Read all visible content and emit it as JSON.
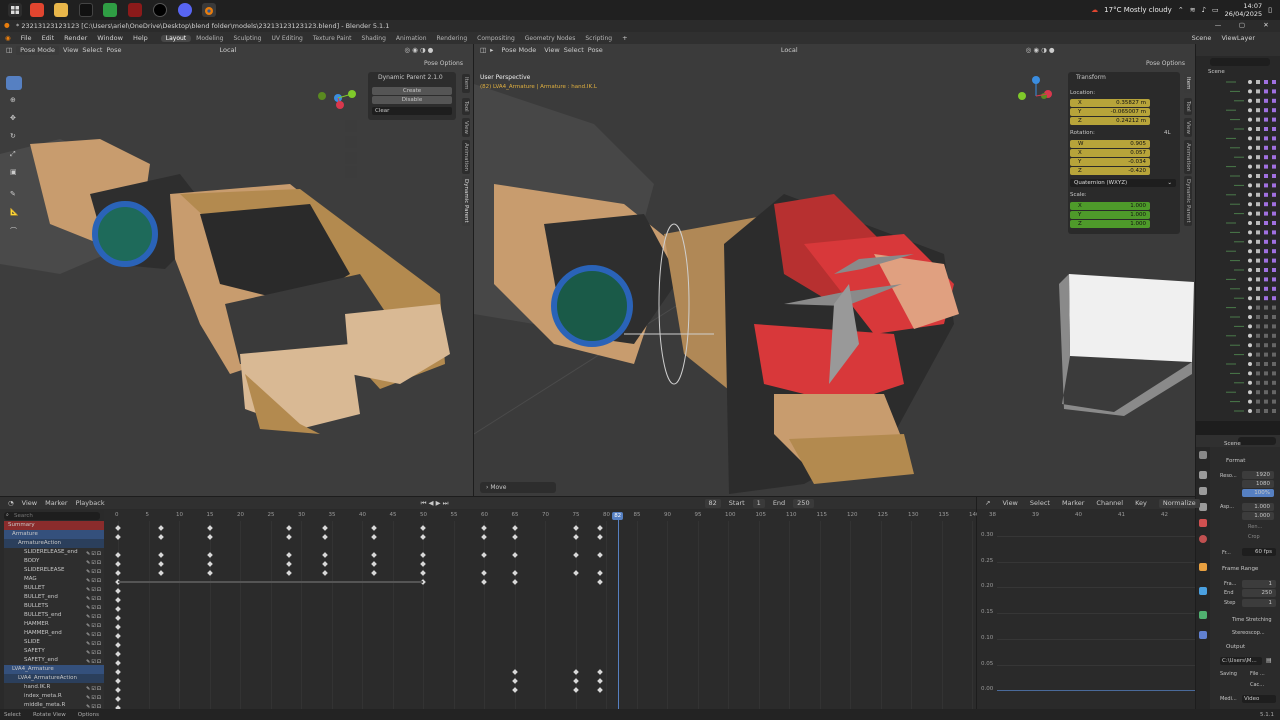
{
  "taskbar": {
    "weather": "17°C  Mostly cloudy",
    "time": "14:07",
    "date": "26/04/2025"
  },
  "window": {
    "title": "* 23213123123123 [C:\\Users\\ariel\\OneDrive\\Desktop\\blend folder\\models\\23213123123123.blend] - Blender 5.1.1"
  },
  "topbar": {
    "menus": [
      "File",
      "Edit",
      "Render",
      "Window",
      "Help"
    ],
    "workspaces": [
      "Layout",
      "Modeling",
      "Sculpting",
      "UV Editing",
      "Texture Paint",
      "Shading",
      "Animation",
      "Rendering",
      "Compositing",
      "Geometry Nodes",
      "Scripting"
    ],
    "active_workspace": "Layout",
    "scene": "Scene",
    "view_layer": "ViewLayer"
  },
  "left_viewport": {
    "mode": "Pose Mode",
    "menus": [
      "View",
      "Select",
      "Pose"
    ],
    "orientation": "Local",
    "pose_options": "Pose Options",
    "dynamic_parent": {
      "title": "Dynamic Parent 2.1.0",
      "create": "Create",
      "disable": "Disable",
      "clear": "Clear"
    },
    "side_tabs": [
      "Item",
      "Tool",
      "View",
      "Animation",
      "Dynamic Parent"
    ]
  },
  "right_viewport": {
    "mode": "Pose Mode",
    "menus": [
      "View",
      "Select",
      "Pose"
    ],
    "orientation": "Local",
    "pose_options": "Pose Options",
    "perspective": "User Perspective",
    "active_info": "(82) LVA4_Armature | Armature : hand.IK.L",
    "operator_panel": "Move",
    "side_tabs": [
      "Item",
      "Tool",
      "View",
      "Animation",
      "Dynamic Parent"
    ],
    "transform": {
      "title": "Transform",
      "location_label": "Location:",
      "location": [
        {
          "axis": "X",
          "value": "0.35827 m"
        },
        {
          "axis": "Y",
          "value": "-0.065007 m"
        },
        {
          "axis": "Z",
          "value": "0.24212 m"
        }
      ],
      "rotation_label": "Rotation:",
      "rotation_mode_short": "4L",
      "rotation": [
        {
          "axis": "W",
          "value": "0.905"
        },
        {
          "axis": "X",
          "value": "0.057"
        },
        {
          "axis": "Y",
          "value": "-0.034"
        },
        {
          "axis": "Z",
          "value": "-0.420"
        }
      ],
      "rotation_mode": "Quaternion (WXYZ)",
      "scale_label": "Scale:",
      "scale": [
        {
          "axis": "X",
          "value": "1.000"
        },
        {
          "axis": "Y",
          "value": "1.000"
        },
        {
          "axis": "Z",
          "value": "1.000"
        }
      ]
    }
  },
  "dope_sheet": {
    "menus": [
      "View",
      "Marker",
      "Playback"
    ],
    "current_frame": "82",
    "start_label": "Start",
    "start": "1",
    "end_label": "End",
    "end": "250",
    "search_placeholder": "Search",
    "ticks": [
      "0",
      "5",
      "10",
      "15",
      "20",
      "25",
      "30",
      "35",
      "40",
      "45",
      "50",
      "55",
      "60",
      "65",
      "70",
      "75",
      "80",
      "85",
      "90",
      "95",
      "100",
      "105",
      "110",
      "115",
      "120",
      "125",
      "130",
      "135",
      "140"
    ],
    "channels": [
      {
        "name": "Summary",
        "kind": "summary"
      },
      {
        "name": "Armature",
        "kind": "object"
      },
      {
        "name": "ArmatureAction",
        "kind": "action"
      },
      {
        "name": "SLIDERELEASE_end",
        "kind": "group"
      },
      {
        "name": "BODY",
        "kind": "group"
      },
      {
        "name": "SLIDERELEASE",
        "kind": "group"
      },
      {
        "name": "MAG",
        "kind": "group"
      },
      {
        "name": "BULLET",
        "kind": "group"
      },
      {
        "name": "BULLET_end",
        "kind": "group"
      },
      {
        "name": "BULLETS",
        "kind": "group"
      },
      {
        "name": "BULLETS_end",
        "kind": "group"
      },
      {
        "name": "HAMMER",
        "kind": "group"
      },
      {
        "name": "HAMMER_end",
        "kind": "group"
      },
      {
        "name": "SLIDE",
        "kind": "group"
      },
      {
        "name": "SAFETY",
        "kind": "group"
      },
      {
        "name": "SAFETY_end",
        "kind": "group"
      },
      {
        "name": "LVA4_Armature",
        "kind": "object"
      },
      {
        "name": "LVA4_ArmatureAction",
        "kind": "action"
      },
      {
        "name": "hand.IK.R",
        "kind": "group"
      },
      {
        "name": "index_meta.R",
        "kind": "group"
      },
      {
        "name": "middle_meta.R",
        "kind": "group"
      }
    ]
  },
  "graph_editor": {
    "menus": [
      "View",
      "Select",
      "Marker",
      "Channel",
      "Key"
    ],
    "normalize": "Normalize",
    "ticks": [
      "38",
      "39",
      "40",
      "41",
      "42"
    ],
    "y_ticks": [
      "0.30",
      "0.25",
      "0.20",
      "0.15",
      "0.10",
      "0.05",
      "0.00"
    ]
  },
  "properties": {
    "scene": "Scene",
    "format": "Format",
    "resolution_label": "Reso...",
    "res_x": "1920",
    "res_y": "1080",
    "res_pct": "100%",
    "aspect_label": "Asp...",
    "aspect_x": "1.000",
    "aspect_y": "1.000",
    "ren": "Ren...",
    "crop": "Crop",
    "frame_rate_label": "Fr...",
    "frame_rate": "60 fps",
    "frame_range": "Frame Range",
    "frame_start_label": "Fra...",
    "frame_start": "1",
    "frame_end_label": "End",
    "frame_end": "250",
    "step_label": "Step",
    "step": "1",
    "time_stretching": "Time Stretching",
    "stereoscopy": "Stereoscop...",
    "output": "Output",
    "output_path": "C:\\Users\\M...",
    "saving": "Saving",
    "file": "File ...",
    "cache": "Cac...",
    "media": "Medi...",
    "video": "Video"
  },
  "statusbar": {
    "items": [
      "Select",
      "Rotate View",
      "Options"
    ],
    "version": "5.1.1"
  }
}
